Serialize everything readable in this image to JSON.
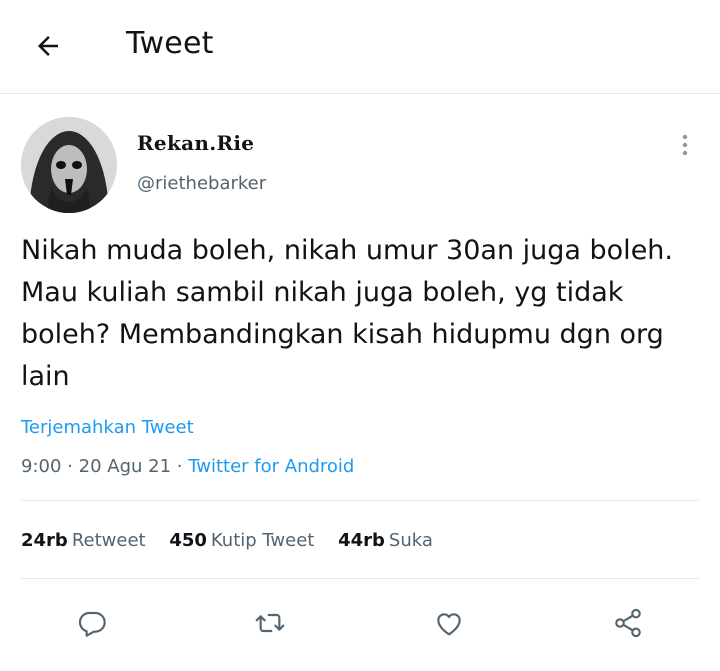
{
  "header": {
    "title": "Tweet",
    "back_icon": "arrow-left-icon"
  },
  "author": {
    "display_name": "Rekan.Rie",
    "handle": "@riethebarker"
  },
  "tweet": {
    "text": "Nikah muda boleh, nikah umur 30an juga boleh.\nMau kuliah sambil nikah juga boleh, yg tidak\nboleh? Membandingkan kisah hidupmu dgn org\nlain",
    "translate_label": "Terjemahkan Tweet",
    "time": "9:00",
    "date": "20 Agu 21",
    "separator": "·",
    "source": "Twitter for Android"
  },
  "stats": {
    "retweets_count": "24rb",
    "retweets_label": "Retweet",
    "quotes_count": "450",
    "quotes_label": "Kutip Tweet",
    "likes_count": "44rb",
    "likes_label": "Suka"
  },
  "actions": [
    "reply-icon",
    "retweet-icon",
    "like-icon",
    "share-icon"
  ],
  "colors": {
    "text_primary": "#0f1419",
    "text_secondary": "#536471",
    "accent": "#1d9bf0",
    "divider": "#e6e9ec"
  }
}
